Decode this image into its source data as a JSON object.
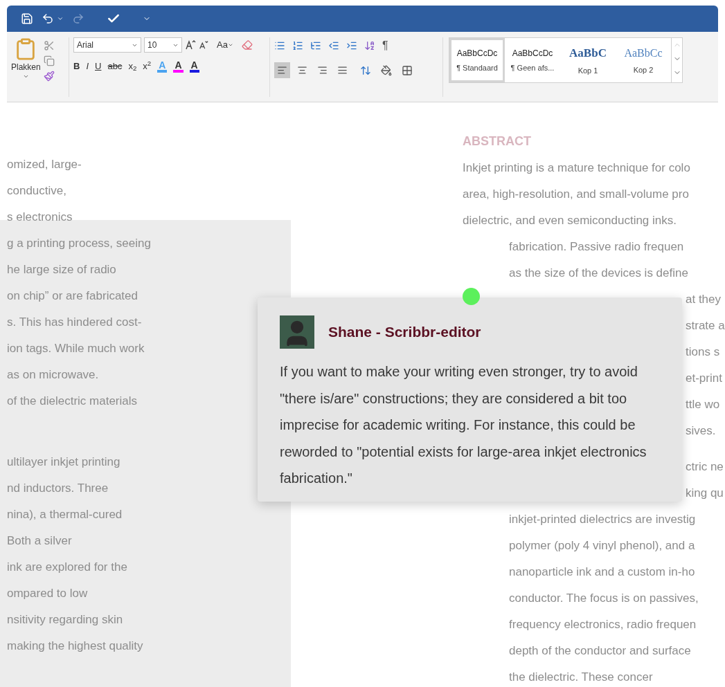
{
  "quick_access": [
    {
      "kind": "save",
      "disabled": false
    },
    {
      "kind": "undo",
      "disabled": false
    },
    {
      "kind": "dropdown",
      "disabled": false
    },
    {
      "kind": "redo",
      "disabled": true
    },
    {
      "kind": "check",
      "disabled": false
    },
    {
      "kind": "customize",
      "disabled": false
    }
  ],
  "clipboard": {
    "paste_label": "Plakken"
  },
  "font": {
    "name": "Arial",
    "size": "10",
    "case_label": "Aa",
    "format_buttons": [
      {
        "label": "B",
        "kind": "bold"
      },
      {
        "label": "I",
        "kind": "italic"
      },
      {
        "label": "U",
        "kind": "underline"
      },
      {
        "label": "abc",
        "kind": "strike"
      },
      {
        "label": "x$_{2}$",
        "kind": "plain"
      },
      {
        "label": "x$^{2}$",
        "kind": "plain"
      }
    ],
    "effects": [
      {
        "label": "A",
        "color": "#4aa3f0"
      },
      {
        "label": "A",
        "color": "#ff00ff"
      },
      {
        "label": "A",
        "color": "#1a1adf"
      }
    ]
  },
  "paragraph": {
    "pilcrow": "¶",
    "alignments": [
      {
        "kind": "left",
        "selected": true
      },
      {
        "kind": "center",
        "selected": false
      },
      {
        "kind": "right",
        "selected": false
      },
      {
        "kind": "justify",
        "selected": false
      }
    ]
  },
  "styles": [
    {
      "preview": "AaBbCcDc",
      "name": "¶ Standaard",
      "kind": "body",
      "selected": true
    },
    {
      "preview": "AaBbCcDc",
      "name": "¶ Geen afs...",
      "kind": "body",
      "selected": false
    },
    {
      "preview": "AaBbC",
      "name": "Kop 1",
      "kind": "heading1",
      "selected": false
    },
    {
      "preview": "AaBbCc",
      "name": "Kop 2",
      "kind": "heading2",
      "selected": false
    }
  ],
  "left_column": [
    [
      "omized, large-",
      "conductive,",
      "s electronics",
      "g a printing process, seeing",
      "he large size of radio",
      "on chip” or are fabricated",
      "s. This has hindered cost-",
      "ion tags. While much work",
      "as on microwave.",
      "of the dielectric materials"
    ],
    [
      "ultilayer inkjet printing",
      "nd inductors. Three",
      "nina), a thermal-cured",
      "Both a silver",
      "ink are explored for the",
      "ompared to low",
      "nsitivity regarding skin",
      "making the highest quality"
    ]
  ],
  "right_column": {
    "heading": "ABSTRACT",
    "lines": [
      "Inkjet printing is a mature technique for colo",
      "area, high-resolution, and small-volume pro",
      "dielectric, and even semiconducting inks."
    ],
    "paragraphs": [
      [
        {
          "text": "fabrication. Passive radio frequen",
          "kind": "full"
        },
        {
          "text": "as the size of the devices is define",
          "kind": "full"
        },
        {
          "text": "at they",
          "kind": "tail"
        },
        {
          "text": "strate a",
          "kind": "tail"
        },
        {
          "text": "tions s",
          "kind": "tail"
        },
        {
          "text": "et-print",
          "kind": "tail"
        },
        {
          "text": "ttle wo",
          "kind": "tail"
        },
        {
          "text": "sives.",
          "kind": "tail"
        }
      ],
      [
        {
          "text": "ctric ne",
          "kind": "tail"
        },
        {
          "text": "king qu",
          "kind": "tail"
        },
        {
          "text": "inkjet-printed dielectrics are investig",
          "kind": "full"
        },
        {
          "text": "polymer (poly 4 vinyl phenol), and a",
          "kind": "full"
        },
        {
          "text": "nanoparticle ink and a custom in-ho",
          "kind": "full"
        },
        {
          "text": "conductor. The focus is on passives,",
          "kind": "full"
        },
        {
          "text": "frequency electronics, radio frequen",
          "kind": "full"
        },
        {
          "text": "depth of the conductor and surface",
          "kind": "full"
        },
        {
          "text": "the dielectric. These concer",
          "kind": "full"
        }
      ]
    ]
  },
  "comment": {
    "author": "Shane - Scribbr-editor",
    "text": "If you want to make your writing even stronger, try to avoid \"there is/are\" constructions; they are considered a bit too imprecise for academic writing. For instance, this could be reworded to \"potential exists for large-area inkjet electronics fabrication.\""
  }
}
